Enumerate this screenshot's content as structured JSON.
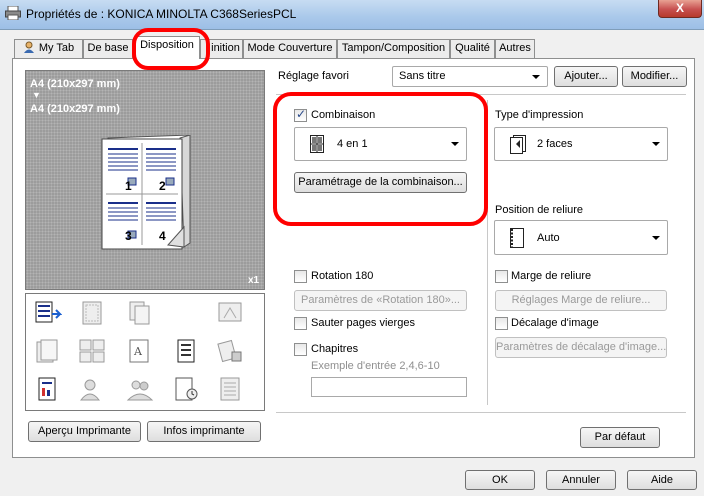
{
  "window": {
    "title": "Propriétés de : KONICA MINOLTA C368SeriesPCL",
    "close_label": "X"
  },
  "tabs": [
    {
      "label": "My Tab"
    },
    {
      "label": "De base"
    },
    {
      "label": "Disposition"
    },
    {
      "label": "inition"
    },
    {
      "label": "Mode Couverture"
    },
    {
      "label": "Tampon/Composition"
    },
    {
      "label": "Qualité"
    },
    {
      "label": "Autres"
    }
  ],
  "preview": {
    "line1": "A4 (210x297 mm)",
    "arrow": "▼",
    "line2": "A4 (210x297 mm)",
    "page_numbers": [
      "1",
      "2",
      "3",
      "4"
    ],
    "multiplier": "x1"
  },
  "left_buttons": {
    "preview_printer": "Aperçu Imprimante",
    "printer_info": "Infos imprimante"
  },
  "favorite": {
    "label": "Réglage favori",
    "value": "Sans titre",
    "add_button": "Ajouter...",
    "modify_button": "Modifier..."
  },
  "combination": {
    "checkbox_label": "Combinaison",
    "checked": true,
    "value": "4 en 1",
    "settings_button": "Paramétrage de la combinaison..."
  },
  "print_type": {
    "label": "Type d'impression",
    "value": "2 faces"
  },
  "binding_position": {
    "label": "Position de reliure",
    "value": "Auto"
  },
  "rotation": {
    "checkbox_label": "Rotation 180",
    "settings_button": "Paramètres de «Rotation 180»..."
  },
  "binding_margin": {
    "checkbox_label": "Marge de reliure",
    "settings_button": "Réglages Marge de reliure..."
  },
  "skip_blank": {
    "checkbox_label": "Sauter pages vierges"
  },
  "image_shift": {
    "checkbox_label": "Décalage d'image",
    "settings_button": "Paramètres de décalage d'image..."
  },
  "chapters": {
    "checkbox_label": "Chapitres",
    "hint": "Exemple d'entrée 2,4,6-10",
    "value": ""
  },
  "default_button": "Par défaut",
  "footer": {
    "ok": "OK",
    "cancel": "Annuler",
    "help": "Aide"
  },
  "annotation_color": "#ff0000"
}
